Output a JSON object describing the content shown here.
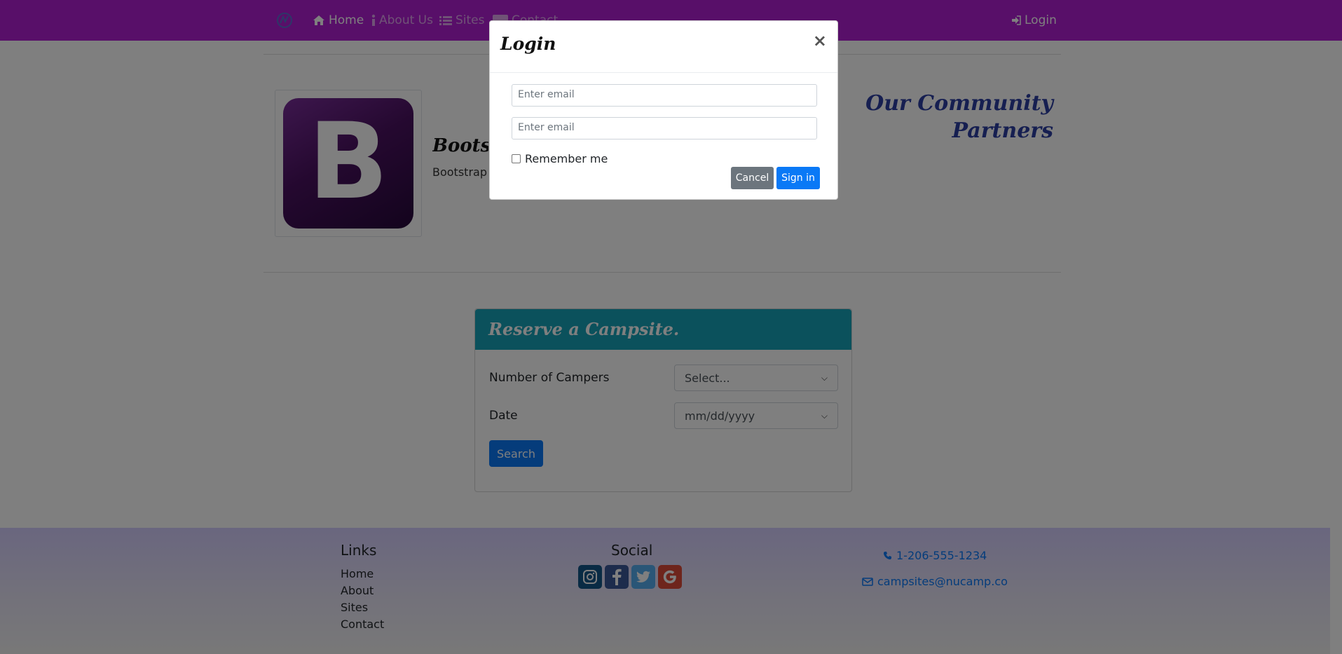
{
  "navbar": {
    "home": "Home",
    "about": "About Us",
    "sites": "Sites",
    "contact": "Contact",
    "login": "Login",
    "colors": {
      "background": "#b01ed3"
    }
  },
  "partner": {
    "logo_letter": "B",
    "name": "Bootstrap",
    "description": "Bootstrap is"
  },
  "community": {
    "title": "Our Community Partners"
  },
  "reserve": {
    "title": "Reserve a Campsite.",
    "campers_label": "Number of Campers",
    "campers_value": "Select...",
    "date_label": "Date",
    "date_value": "mm/dd/yyyy",
    "search_label": "Search"
  },
  "footer": {
    "links_title": "Links",
    "links": [
      "Home",
      "About",
      "Sites",
      "Contact"
    ],
    "social_title": "Social",
    "social_icons": [
      "instagram-icon",
      "facebook-icon",
      "twitter-icon",
      "google-icon"
    ],
    "phone": "1-206-555-1234",
    "email": "campsites@nucamp.co"
  },
  "modal": {
    "title": "Login",
    "close": "×",
    "email_placeholder": "Enter email",
    "password_placeholder": "Enter email",
    "remember": "Remember me",
    "cancel": "Cancel",
    "signin": "Sign in"
  }
}
